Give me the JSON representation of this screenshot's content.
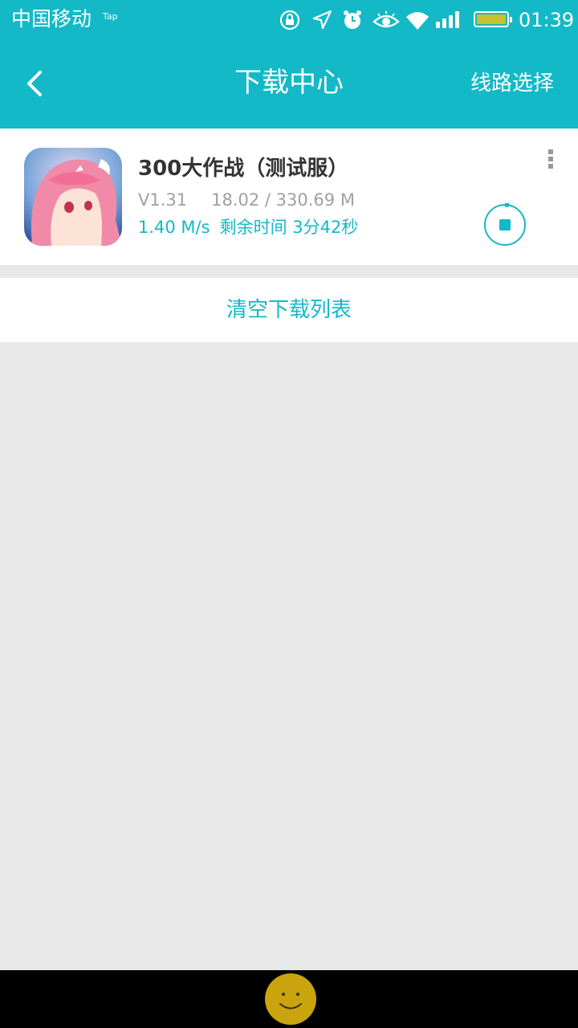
{
  "status_bar": {
    "carrier": "中国移动",
    "carrier_tag": "Tap",
    "time": "01:39",
    "icons": [
      "rotation-lock-icon",
      "location-icon",
      "alarm-icon",
      "eye-icon",
      "wifi-icon",
      "signal-icon",
      "battery-icon"
    ]
  },
  "app_bar": {
    "title": "下载中心",
    "route_label": "线路选择"
  },
  "download_item": {
    "name": "300大作战（测试服）",
    "version": "V1.31",
    "size_progress": "18.02 / 330.69 M",
    "speed": "1.40 M/s",
    "remaining": "剩余时间 3分42秒"
  },
  "clear_label": "清空下载列表",
  "colors": {
    "accent": "#13b9c6",
    "background": "#e8e8e8",
    "title_text": "#333333",
    "meta_text": "#a0a0a0",
    "battery": "#c6c12c",
    "smiley": "#c9a40c"
  }
}
